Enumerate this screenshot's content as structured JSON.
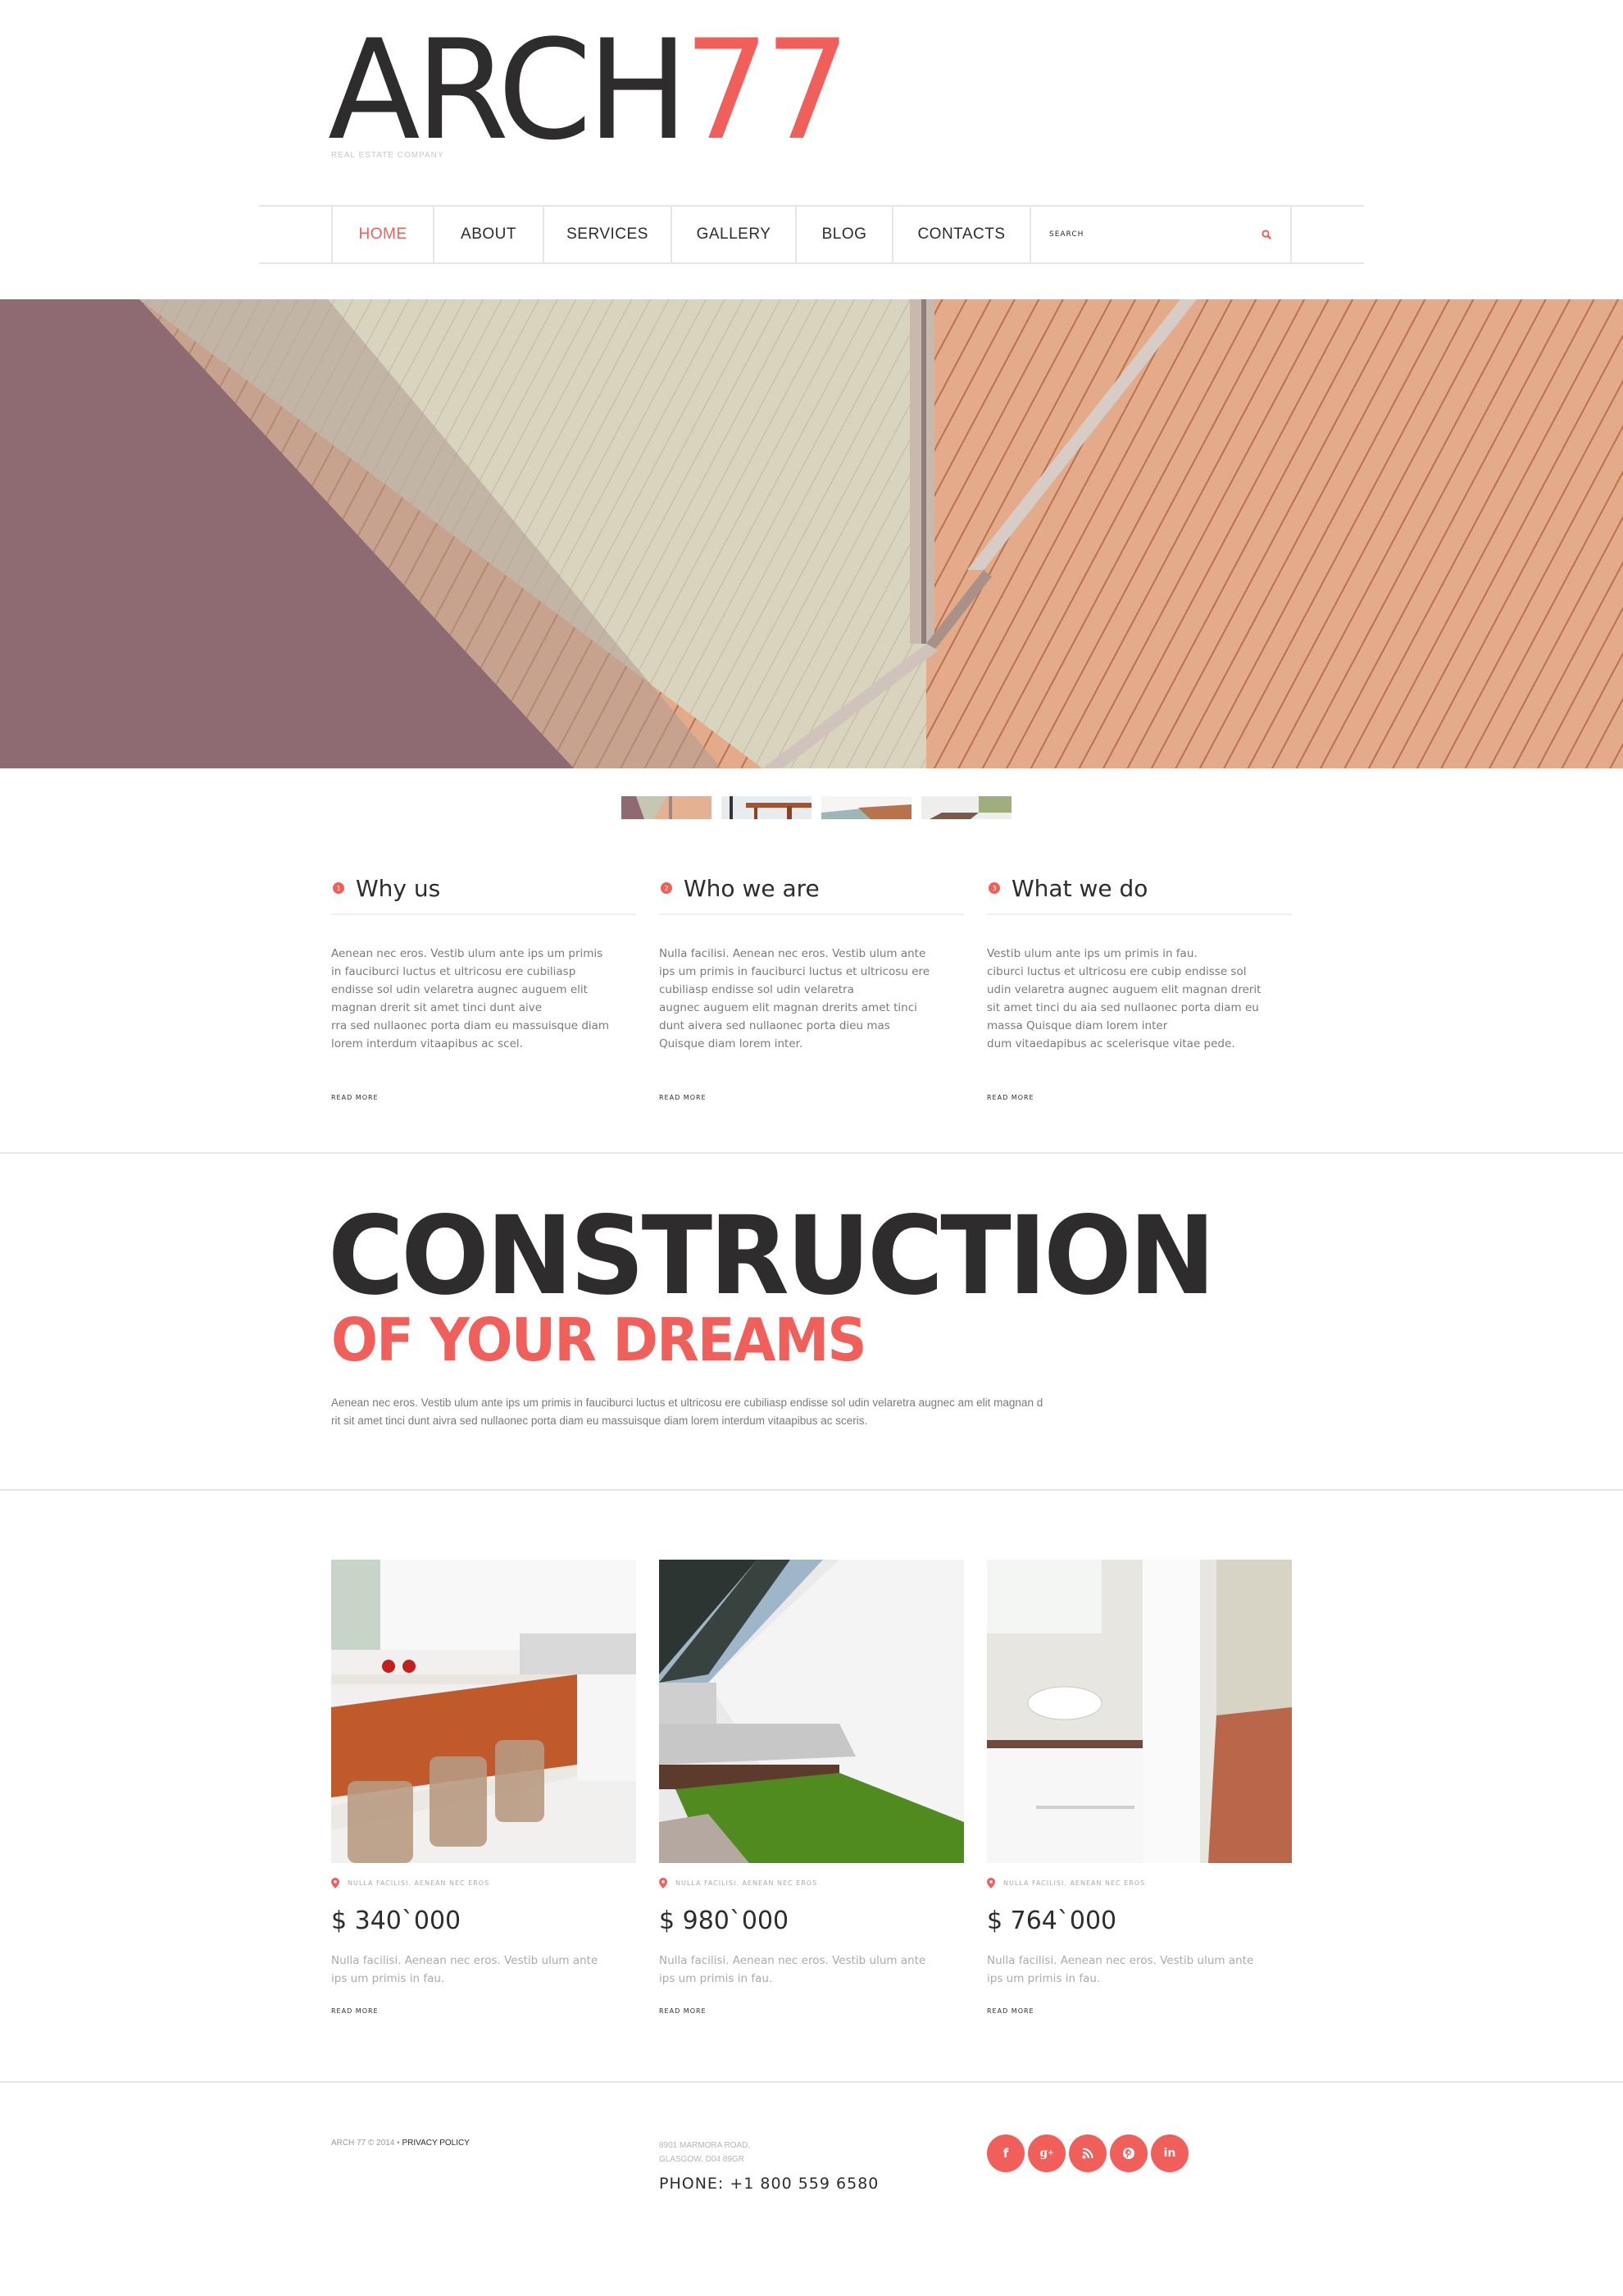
{
  "brand": {
    "name": "ARCH",
    "name_accent": "77",
    "tagline": "REAL ESTATE COMPANY",
    "accent_color": "#f05f5a",
    "dark_color": "#2e2c2d"
  },
  "nav": {
    "items": [
      {
        "label": "HOME",
        "active": true
      },
      {
        "label": "ABOUT",
        "active": false
      },
      {
        "label": "SERVICES",
        "active": false
      },
      {
        "label": "GALLERY",
        "active": false
      },
      {
        "label": "BLOG",
        "active": false
      },
      {
        "label": "CONTACTS",
        "active": false
      }
    ],
    "search": {
      "placeholder": "SEARCH",
      "value": "",
      "icon": "search-icon"
    }
  },
  "hero": {
    "image": "wooden-deck-glass-door-photo",
    "thumbnails": [
      {
        "subject": "wooden-deck-glass-door",
        "active": true
      },
      {
        "subject": "dining-table-chairs",
        "active": false
      },
      {
        "subject": "pool-wooden-deck",
        "active": false
      },
      {
        "subject": "bright-room-window",
        "active": false
      }
    ]
  },
  "features": [
    {
      "number": "1",
      "title": "Why us",
      "text": "Aenean nec eros. Vestib ulum ante ips um primis\nin fauciburci luctus et ultricosu ere cubiliasp\nendisse sol udin velaretra augnec auguem elit\nmagnan drerit sit amet tinci dunt aive\nrra sed nullaonec porta diam eu massuisque diam\nlorem interdum vitaapibus ac scel.",
      "link": "READ MORE"
    },
    {
      "number": "2",
      "title": "Who we are",
      "text": "Nulla facilisi. Aenean nec eros. Vestib ulum ante\nips um primis in fauciburci luctus et ultricosu ere\ncubiliasp endisse sol udin velaretra\naugnec auguem elit magnan drerits amet tinci\ndunt aivera sed nullaonec porta dieu mas\n Quisque diam lorem inter.",
      "link": "READ MORE"
    },
    {
      "number": "3",
      "title": "What we do",
      "text": "Vestib ulum ante ips um primis in fau.\n ciburci luctus et ultricosu ere cubip endisse sol\nudin velaretra augnec auguem elit magnan drerit\nsit amet tinci du aia sed nullaonec porta diam eu\nmassa Quisque diam lorem inter\ndum vitaedapibus ac scelerisque vitae pede.",
      "link": "READ MORE"
    }
  ],
  "promo": {
    "title": "CONSTRUCTION",
    "subtitle": "OF YOUR DREAMS",
    "text": "Aenean nec eros. Vestib ulum ante ips um primis in fauciburci luctus et ultricosu ere cubiliasp endisse sol udin velaretra augnec am elit magnan d\nrit sit amet tinci dunt aivra sed nullaonec porta diam eu massuisque diam lorem interdum vitaapibus ac sceris."
  },
  "properties": [
    {
      "image": "kitchen-interior-photo",
      "location": "NULLA FACILISI. AENEAN NEC EROS",
      "price": "$ 340`000",
      "text": "Nulla facilisi. Aenean nec eros. Vestib ulum ante\nips um primis in fau.",
      "link": "READ MORE"
    },
    {
      "image": "courtyard-lawn-photo",
      "location": "NULLA FACILISI. AENEAN NEC EROS",
      "price": "$ 980`000",
      "text": "Nulla facilisi. Aenean nec eros. Vestib ulum ante\nips um primis in fau.",
      "link": "READ MORE"
    },
    {
      "image": "bathroom-interior-photo",
      "location": "NULLA FACILISI. AENEAN NEC EROS",
      "price": "$ 764`000",
      "text": "Nulla facilisi. Aenean nec eros. Vestib ulum ante\nips um primis in fau.",
      "link": "READ MORE"
    }
  ],
  "footer": {
    "copyright": "ARCH 77 © 2014 • ",
    "privacy": "PRIVACY POLICY",
    "address": "8901 MARMORA ROAD,\nGLASGOW, D04 89GR",
    "phone": "PHONE:  +1 800 559 6580",
    "socials": [
      {
        "name": "facebook",
        "glyph": "f"
      },
      {
        "name": "google-plus",
        "glyph": "g+"
      },
      {
        "name": "rss",
        "glyph": "rss"
      },
      {
        "name": "pinterest",
        "glyph": "p"
      },
      {
        "name": "linkedin",
        "glyph": "in"
      }
    ]
  }
}
